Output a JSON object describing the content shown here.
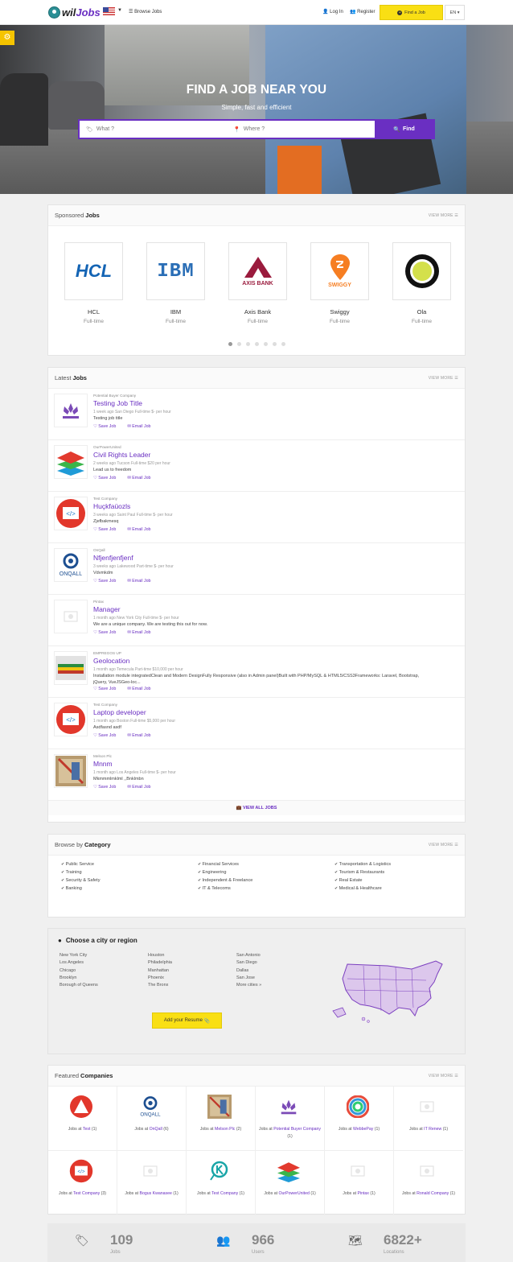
{
  "header": {
    "logo_prefix": "wil",
    "logo_suffix": "Jobs",
    "browse_jobs": "Browse Jobs",
    "login": "Log In",
    "register": "Register",
    "find_job": "Find a Job",
    "lang": "EN"
  },
  "hero": {
    "title": "FIND A JOB NEAR YOU",
    "subtitle": "Simple, fast and efficient",
    "what_placeholder": "What ?",
    "where_placeholder": "Where ?",
    "find_button": "Find"
  },
  "sponsored": {
    "heading_light": "Sponsored",
    "heading_bold": "Jobs",
    "view_more": "VIEW MORE",
    "items": [
      {
        "name": "HCL",
        "type": "Full-time"
      },
      {
        "name": "IBM",
        "type": "Full-time"
      },
      {
        "name": "Axis Bank",
        "type": "Full-time"
      },
      {
        "name": "Swiggy",
        "type": "Full-time"
      },
      {
        "name": "Ola",
        "type": "Full-time"
      }
    ],
    "logo_texts": {
      "hcl": "HCL",
      "ibm": "IBM",
      "axis": "AXIS BANK",
      "swiggy": "SWIGGY"
    }
  },
  "latest": {
    "heading_light": "Latest",
    "heading_bold": "Jobs",
    "view_more": "VIEW MORE",
    "view_all": "VIEW ALL JOBS",
    "save_label": "Save Job",
    "email_label": "Email Job",
    "jobs": [
      {
        "company": "Potential Buyer Company",
        "title": "Testing Job Title",
        "meta": "1 week ago   San Diego   Full-time   $- per hour",
        "desc": "Testing job title"
      },
      {
        "company": "OurPowerUnited",
        "title": "Civil Rights Leader",
        "meta": "2 weeks ago   Tucson   Full-time   $20 per hour",
        "desc": "Lead us to freedom"
      },
      {
        "company": "Test Company",
        "title": "Huçkfaüozls",
        "meta": "3 weeks ago   Saint Paul   Full-time   $- per hour",
        "desc": "Zjefbakmesq"
      },
      {
        "company": "OnQall",
        "title": "Nfjenfjenfjenf",
        "meta": "3 weeks ago   Lakewood   Part-time   $- per hour",
        "desc": "Vdvmkdm"
      },
      {
        "company": "Pintax",
        "title": "Manager",
        "meta": "1 month ago   New York City   Full-time   $- per hour",
        "desc": "We are a unique company. We are testing this out for now."
      },
      {
        "company": "EMPREGOS UP",
        "title": "Geolocation",
        "meta": "1 month ago   Temecula   Part-time   $10,000 per hour",
        "desc": "Installation module integratedClean and Modern DesignFully Responsive (also in Admin panel)Built with PHP/MySQL & HTML5/CSS3Frameworks: Laravel, Bootstrap, jQuery, VueJSGeo-loc..."
      },
      {
        "company": "Test Company",
        "title": "Laptop developer",
        "meta": "1 month ago   Boston   Full-time   $5,000 per hour",
        "desc": "Asdfasnd asdf"
      },
      {
        "company": "Melson Plc",
        "title": "Mnnm",
        "meta": "1 month ago   Los Angeles   Full-time   $- per hour",
        "desc": "Mkmmmlmklml ,,Bnklmbn"
      }
    ]
  },
  "category": {
    "heading_light": "Browse by",
    "heading_bold": "Category",
    "view_more": "VIEW MORE",
    "items": [
      "Public Service",
      "Financial Services",
      "Transportation & Logistics",
      "Training",
      "Engineering",
      "Tourism & Restaurants",
      "Security & Safety",
      "Independent & Freelance",
      "Real Estate",
      "Banking",
      "IT & Telecoms",
      "Medical & Healthcare"
    ]
  },
  "region": {
    "heading": "Choose a city or region",
    "cities": [
      "New York City",
      "Houston",
      "San Antonio",
      "Los Angeles",
      "Philadelphia",
      "San Diego",
      "Chicago",
      "Manhattan",
      "Dallas",
      "Brooklyn",
      "Phoenix",
      "San Jose",
      "Borough of Queens",
      "The Bronx",
      "More cities »"
    ],
    "resume_button": "Add your Resume"
  },
  "featured": {
    "heading_light": "Featured",
    "heading_bold": "Companies",
    "view_more": "VIEW MORE",
    "jobs_at": "Jobs at",
    "companies": [
      {
        "name": "Test",
        "count": "(1)"
      },
      {
        "name": "OnQall",
        "count": "(6)"
      },
      {
        "name": "Melson Plc",
        "count": "(2)"
      },
      {
        "name": "Potential Buyer Company",
        "count": "(1)"
      },
      {
        "name": "WebbePay",
        "count": "(1)"
      },
      {
        "name": "IT Renew",
        "count": "(1)"
      },
      {
        "name": "Test Company",
        "count": "(3)"
      },
      {
        "name": "Bogus Kwanasee",
        "count": "(1)"
      },
      {
        "name": "Test Company",
        "count": "(1)"
      },
      {
        "name": "OurPowerUnited",
        "count": "(1)"
      },
      {
        "name": "Pintax",
        "count": "(1)"
      },
      {
        "name": "Ronald Company",
        "count": "(1)"
      }
    ]
  },
  "stats": [
    {
      "number": "109",
      "label": "Jobs"
    },
    {
      "number": "966",
      "label": "Users"
    },
    {
      "number": "6822+",
      "label": "Locations"
    }
  ],
  "colors": {
    "brand": "#6a2fc2",
    "accent": "#f9df14"
  }
}
